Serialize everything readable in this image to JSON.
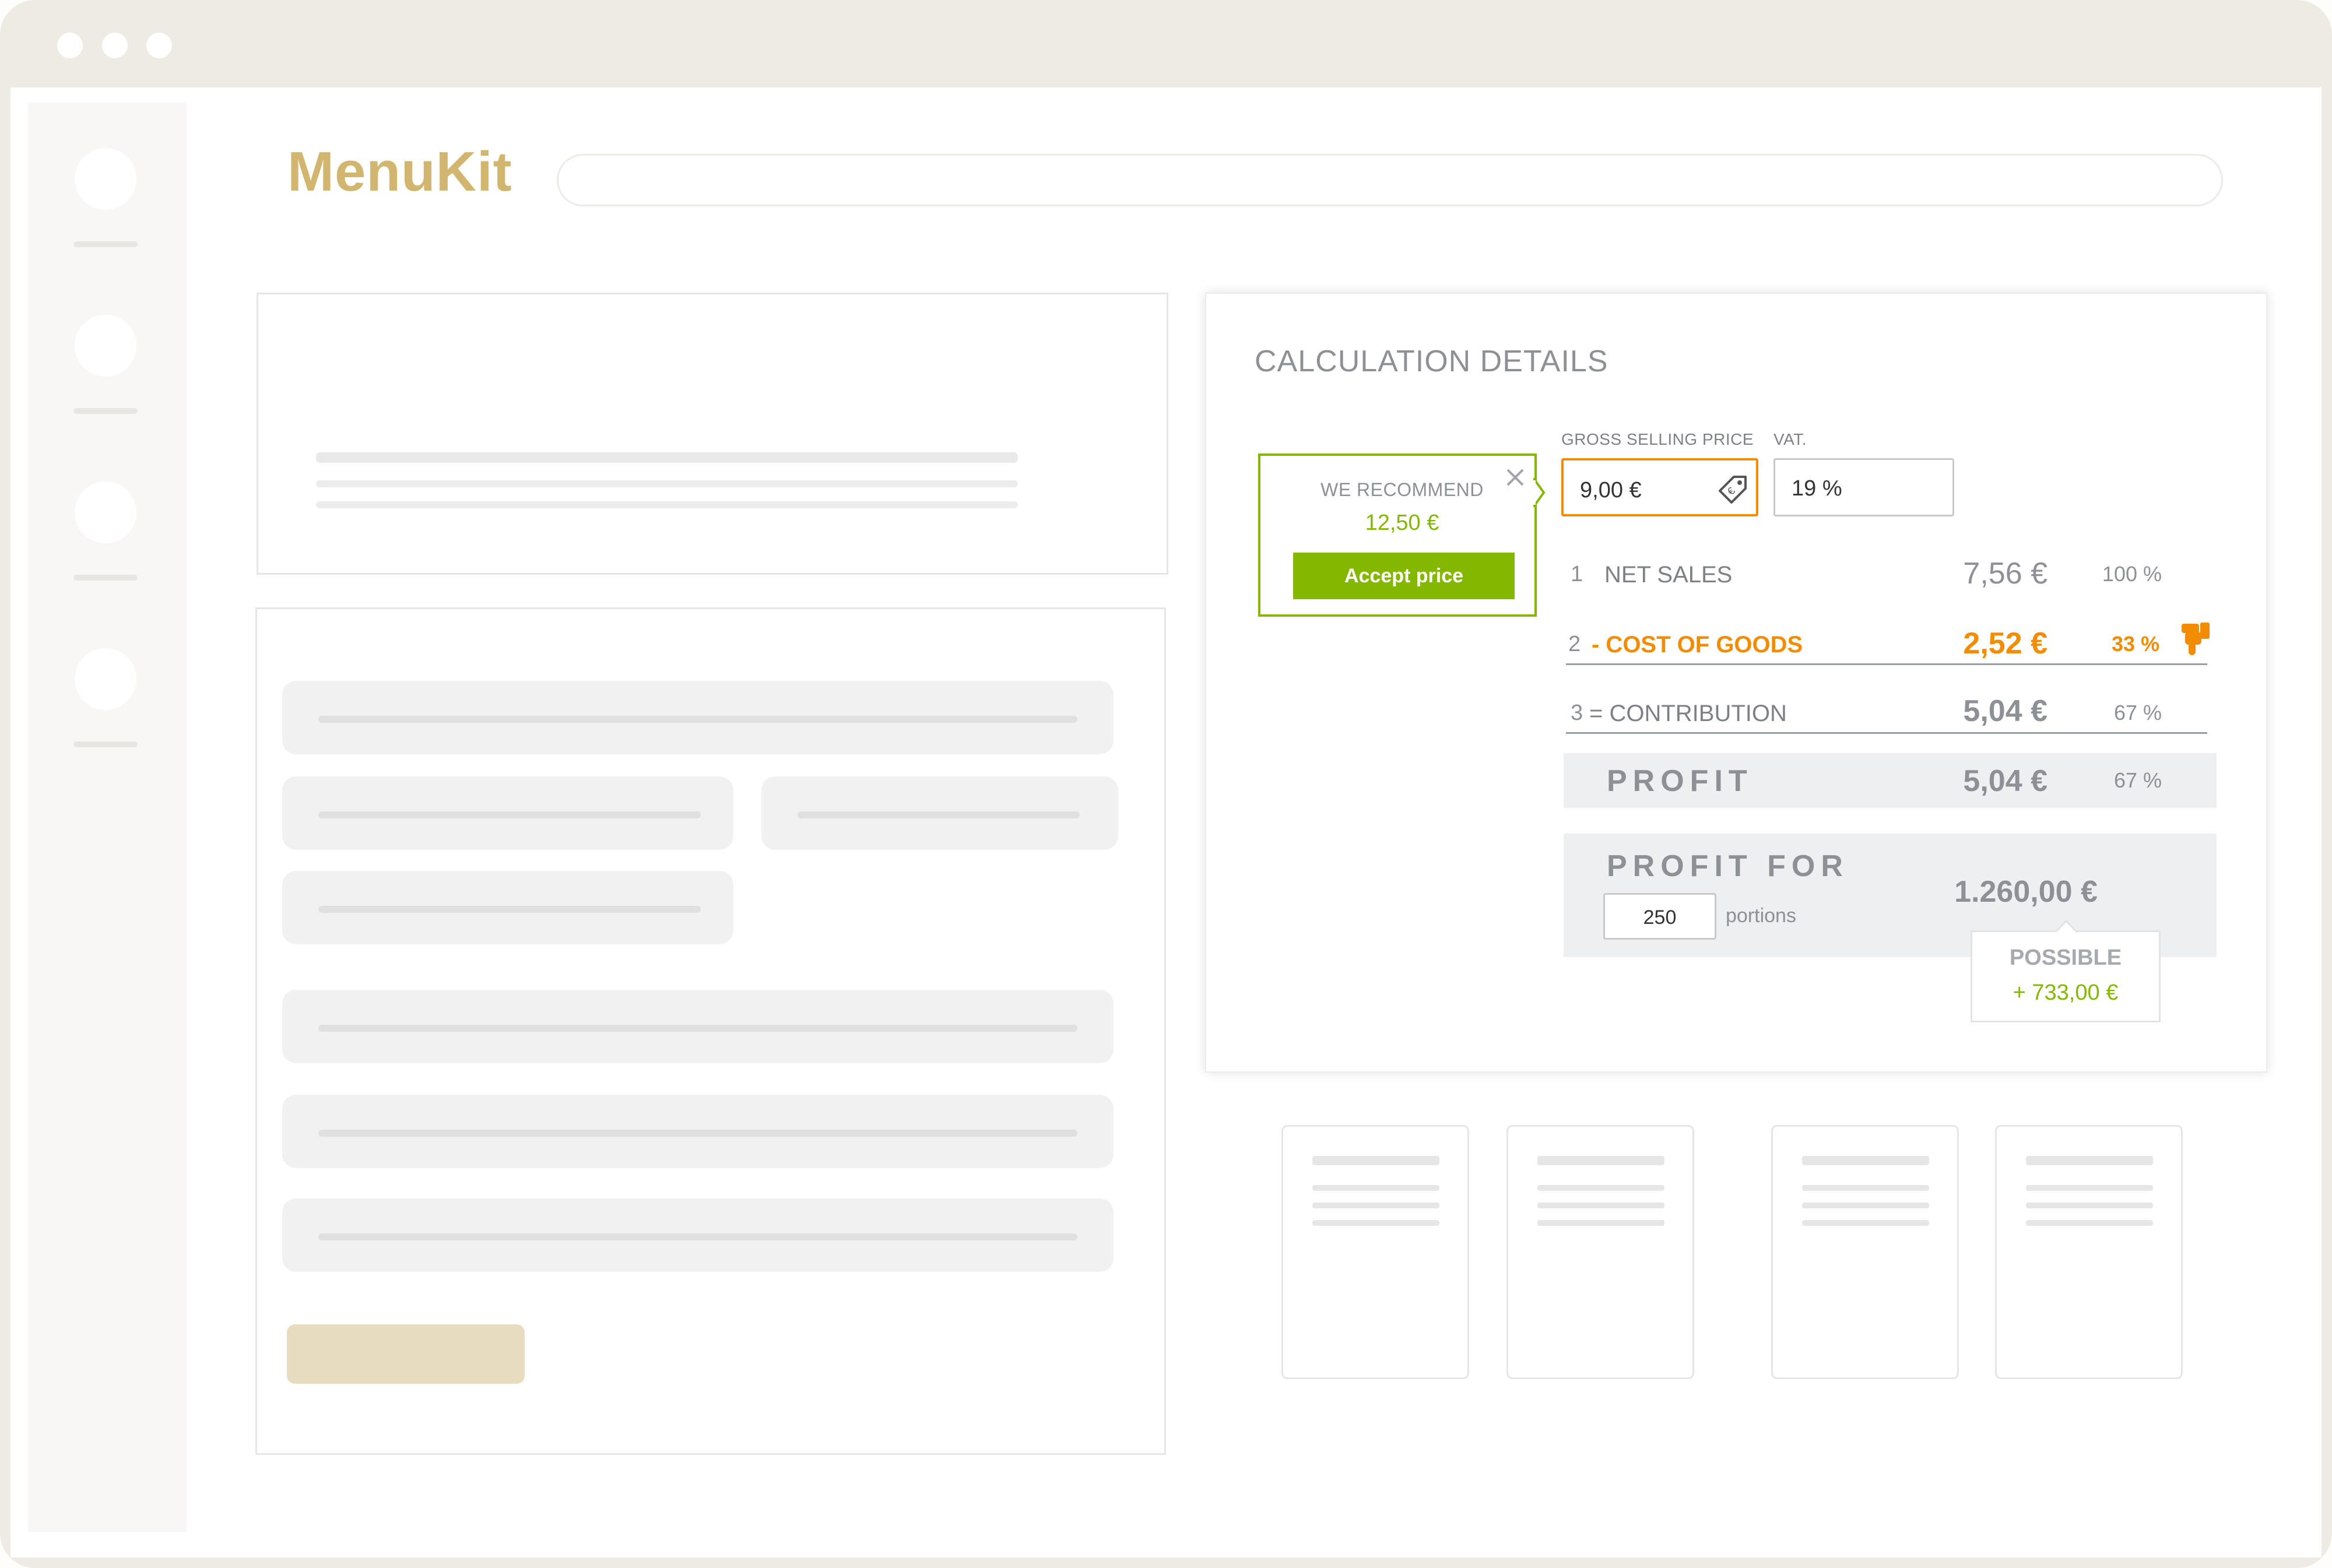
{
  "app": {
    "logo_text": "MenuKit",
    "search": {
      "value": ""
    }
  },
  "calculation": {
    "title": "CALCULATION DETAILS",
    "recommend": {
      "label": "WE RECOMMEND",
      "price": "12,50 €",
      "accept_label": "Accept price",
      "close_icon": "close-icon"
    },
    "gross_price": {
      "label": "GROSS SELLING PRICE",
      "value": "9,00 €",
      "icon": "price-tag-icon"
    },
    "vat": {
      "label": "VAT.",
      "value": "19 %"
    },
    "rows": [
      {
        "num": "1",
        "label": "NET SALES",
        "amount": "7,56 €",
        "percent": "100 %"
      },
      {
        "num": "2",
        "label": "- COST OF GOODS",
        "amount": "2,52 €",
        "percent": "33 %",
        "icon": "thumb-down-icon"
      },
      {
        "num": "3",
        "label": "= CONTRIBUTION",
        "amount": "5,04 €",
        "percent": "67 %"
      }
    ],
    "profit": {
      "label": "PROFIT",
      "amount": "5,04 €",
      "percent": "67 %"
    },
    "profit_for": {
      "label": "PROFIT FOR",
      "portions_value": "250",
      "portions_label": "portions",
      "amount": "1.260,00 €",
      "possible_label": "POSSIBLE",
      "possible_value": "+ 733,00 €"
    }
  },
  "colors": {
    "accent_orange": "#f28c00",
    "accent_green": "#84b800",
    "logo_gold": "#d2b56e",
    "chrome": "#eeebe3"
  }
}
